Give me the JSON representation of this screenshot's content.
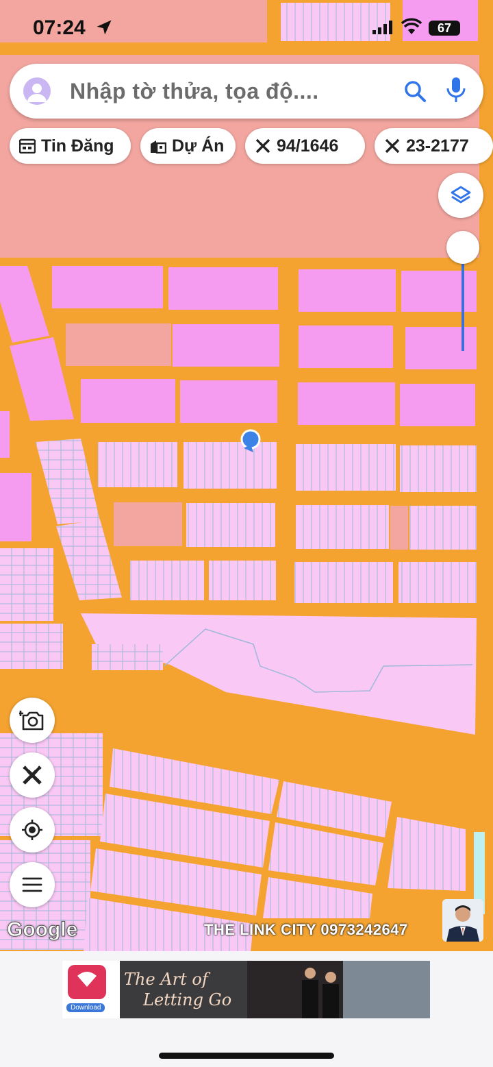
{
  "status_bar": {
    "time": "07:24",
    "battery": "67"
  },
  "search": {
    "placeholder": "Nhập tờ thửa, tọa độ...."
  },
  "chips": [
    {
      "label": "Tin Đăng",
      "icon": "calendar-icon"
    },
    {
      "label": "Dự Án",
      "icon": "buildings-icon"
    },
    {
      "label": "94/1646",
      "icon": "ruler-cross-icon"
    },
    {
      "label": "23-2177",
      "icon": "ruler-cross-icon"
    }
  ],
  "map": {
    "attribution": "Google",
    "watermark": "THE LINK CITY 0973242647",
    "colors": {
      "road": "#f4a330",
      "residential_dense": "#f59cf0",
      "residential_light": "#f9c8f5",
      "mixed": "#f3a6a0",
      "marker": "#3d82e6"
    }
  },
  "controls": {
    "layers_icon": "layers-icon",
    "camera_icon": "camera-add-icon",
    "ruler_icon": "ruler-cross-icon",
    "locate_icon": "crosshair-icon",
    "menu_icon": "menu-icon"
  },
  "ad": {
    "title_line1": "The Art of",
    "title_line2": "Letting Go",
    "download_label": "Download"
  }
}
